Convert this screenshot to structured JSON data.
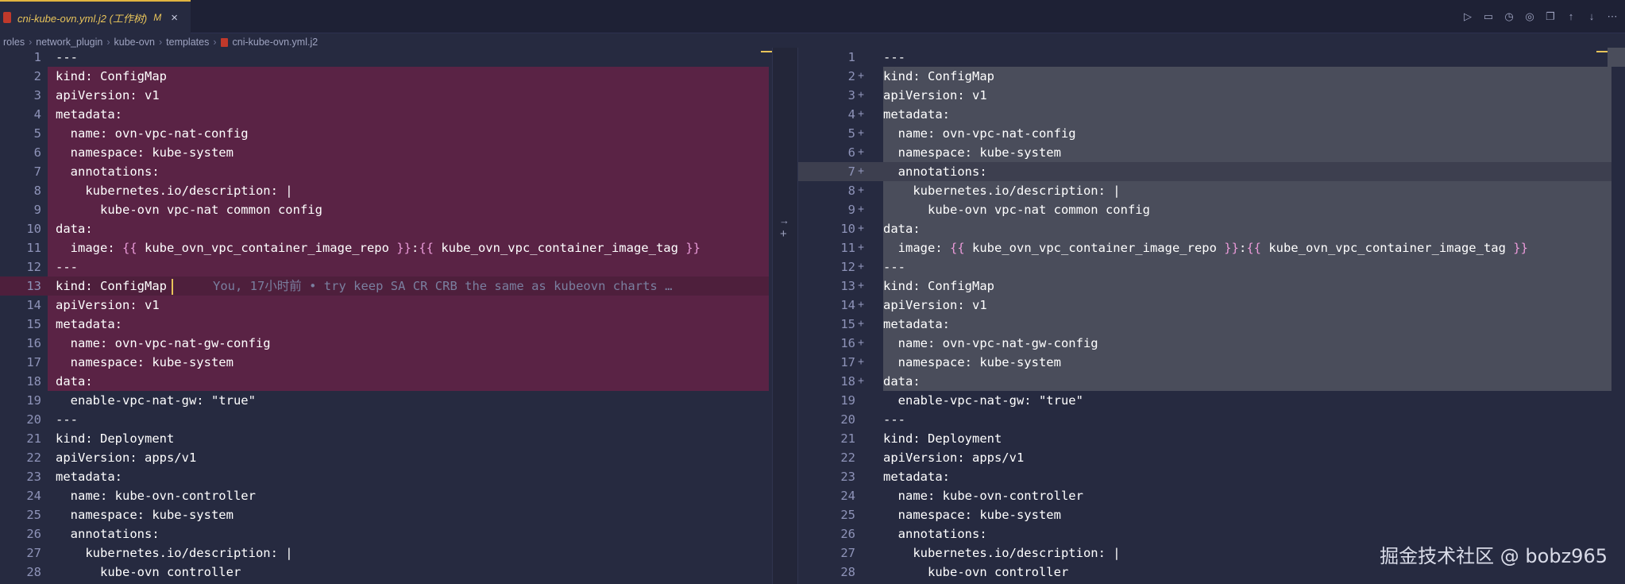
{
  "tab": {
    "title": "cni-kube-ovn.yml.j2 (工作树)",
    "modified": "M",
    "close": "×"
  },
  "breadcrumb": [
    "roles",
    "network_plugin",
    "kube-ovn",
    "templates",
    "cni-kube-ovn.yml.j2"
  ],
  "toolbar_icons": [
    "run-icon",
    "comment-icon",
    "history-icon",
    "check-icon",
    "copy-icon",
    "arrow-up-icon",
    "arrow-down-icon",
    "more-icon"
  ],
  "left": {
    "lines": [
      {
        "n": "1",
        "text": "---",
        "m": ""
      },
      {
        "n": "2",
        "text": "kind: ConfigMap",
        "m": ""
      },
      {
        "n": "3",
        "text": "apiVersion: v1",
        "m": ""
      },
      {
        "n": "4",
        "text": "metadata:",
        "m": ""
      },
      {
        "n": "5",
        "text": "  name: ovn-vpc-nat-config",
        "m": ""
      },
      {
        "n": "6",
        "text": "  namespace: kube-system",
        "m": ""
      },
      {
        "n": "7",
        "text": "  annotations:",
        "m": ""
      },
      {
        "n": "8",
        "text": "    kubernetes.io/description: |",
        "m": ""
      },
      {
        "n": "9",
        "text": "      kube-ovn vpc-nat common config",
        "m": ""
      },
      {
        "n": "10",
        "text": "data:",
        "m": ""
      },
      {
        "n": "11",
        "text": "  image: {{ kube_ovn_vpc_container_image_repo }}:{{ kube_ovn_vpc_container_image_tag }}",
        "m": ""
      },
      {
        "n": "12",
        "text": "---",
        "m": ""
      },
      {
        "n": "13",
        "text": "kind: ConfigMap",
        "m": ""
      },
      {
        "n": "14",
        "text": "apiVersion: v1",
        "m": ""
      },
      {
        "n": "15",
        "text": "metadata:",
        "m": ""
      },
      {
        "n": "16",
        "text": "  name: ovn-vpc-nat-gw-config",
        "m": ""
      },
      {
        "n": "17",
        "text": "  namespace: kube-system",
        "m": ""
      },
      {
        "n": "18",
        "text": "data:",
        "m": ""
      },
      {
        "n": "19",
        "text": "  enable-vpc-nat-gw: \"true\"",
        "m": ""
      },
      {
        "n": "20",
        "text": "---",
        "m": ""
      },
      {
        "n": "21",
        "text": "kind: Deployment",
        "m": ""
      },
      {
        "n": "22",
        "text": "apiVersion: apps/v1",
        "m": ""
      },
      {
        "n": "23",
        "text": "metadata:",
        "m": ""
      },
      {
        "n": "24",
        "text": "  name: kube-ovn-controller",
        "m": ""
      },
      {
        "n": "25",
        "text": "  namespace: kube-system",
        "m": ""
      },
      {
        "n": "26",
        "text": "  annotations:",
        "m": ""
      },
      {
        "n": "27",
        "text": "    kubernetes.io/description: |",
        "m": ""
      },
      {
        "n": "28",
        "text": "      kube-ovn controller",
        "m": ""
      }
    ],
    "blame": "You, 17小时前 • try keep SA CR CRB the same as kubeovn charts …"
  },
  "right": {
    "lines": [
      {
        "n": "1",
        "text": "---",
        "m": ""
      },
      {
        "n": "2",
        "text": "kind: ConfigMap",
        "m": "+"
      },
      {
        "n": "3",
        "text": "apiVersion: v1",
        "m": "+"
      },
      {
        "n": "4",
        "text": "metadata:",
        "m": "+"
      },
      {
        "n": "5",
        "text": "  name: ovn-vpc-nat-config",
        "m": "+"
      },
      {
        "n": "6",
        "text": "  namespace: kube-system",
        "m": "+"
      },
      {
        "n": "7",
        "text": "  annotations:",
        "m": "+"
      },
      {
        "n": "8",
        "text": "    kubernetes.io/description: |",
        "m": "+"
      },
      {
        "n": "9",
        "text": "      kube-ovn vpc-nat common config",
        "m": "+"
      },
      {
        "n": "10",
        "text": "data:",
        "m": "+"
      },
      {
        "n": "11",
        "text": "  image: {{ kube_ovn_vpc_container_image_repo }}:{{ kube_ovn_vpc_container_image_tag }}",
        "m": "+"
      },
      {
        "n": "12",
        "text": "---",
        "m": "+"
      },
      {
        "n": "13",
        "text": "kind: ConfigMap",
        "m": "+"
      },
      {
        "n": "14",
        "text": "apiVersion: v1",
        "m": "+"
      },
      {
        "n": "15",
        "text": "metadata:",
        "m": "+"
      },
      {
        "n": "16",
        "text": "  name: ovn-vpc-nat-gw-config",
        "m": "+"
      },
      {
        "n": "17",
        "text": "  namespace: kube-system",
        "m": "+"
      },
      {
        "n": "18",
        "text": "data:",
        "m": "+"
      },
      {
        "n": "19",
        "text": "  enable-vpc-nat-gw: \"true\"",
        "m": ""
      },
      {
        "n": "20",
        "text": "---",
        "m": ""
      },
      {
        "n": "21",
        "text": "kind: Deployment",
        "m": ""
      },
      {
        "n": "22",
        "text": "apiVersion: apps/v1",
        "m": ""
      },
      {
        "n": "23",
        "text": "metadata:",
        "m": ""
      },
      {
        "n": "24",
        "text": "  name: kube-ovn-controller",
        "m": ""
      },
      {
        "n": "25",
        "text": "  namespace: kube-system",
        "m": ""
      },
      {
        "n": "26",
        "text": "  annotations:",
        "m": ""
      },
      {
        "n": "27",
        "text": "    kubernetes.io/description: |",
        "m": ""
      },
      {
        "n": "28",
        "text": "      kube-ovn controller",
        "m": ""
      }
    ]
  },
  "separator": {
    "arrow": "→",
    "plus": "+"
  },
  "watermark": "掘金技术社区 @ bobz965",
  "colors": {
    "deleted": "#5a2345",
    "inserted": "#4a4d5b",
    "accent": "#e8c45a",
    "brace": "#e99ad8"
  }
}
